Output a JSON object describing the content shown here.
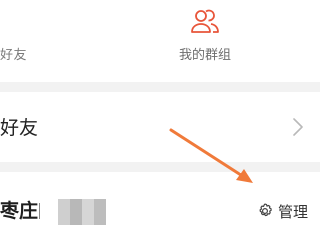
{
  "top_tabs": {
    "friends_partial_label": "好友",
    "my_groups_label": "我的群组"
  },
  "friends_row": {
    "label": "好友"
  },
  "village_row": {
    "name": "枣庄",
    "manage_label": "管理"
  },
  "colors": {
    "accent": "#e8553a",
    "annotation_arrow": "#f07a3a",
    "divider": "#f2f2f2"
  },
  "icons": {
    "group": "group-people-icon",
    "chevron": "chevron-right-icon",
    "gear": "gear-icon"
  }
}
